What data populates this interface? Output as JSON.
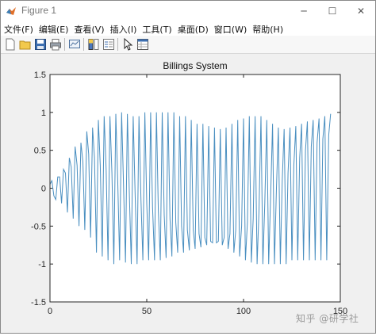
{
  "window": {
    "title": "Figure 1",
    "controls": {
      "minimize": "─",
      "maximize": "☐",
      "close": "✕"
    }
  },
  "menu": [
    {
      "label": "文件(F)"
    },
    {
      "label": "编辑(E)"
    },
    {
      "label": "查看(V)"
    },
    {
      "label": "插入(I)"
    },
    {
      "label": "工具(T)"
    },
    {
      "label": "桌面(D)"
    },
    {
      "label": "窗口(W)"
    },
    {
      "label": "帮助(H)"
    }
  ],
  "toolbar": {
    "icons": [
      "new-figure-icon",
      "open-file-icon",
      "save-icon",
      "print-icon",
      "link-plot-icon",
      "insert-colorbar-icon",
      "insert-legend-icon",
      "edit-plot-arrow-icon",
      "property-inspector-icon"
    ]
  },
  "chart_data": {
    "type": "line",
    "title": "Billings System",
    "xlabel": "",
    "ylabel": "",
    "xlim": [
      0,
      150
    ],
    "ylim": [
      -1.5,
      1.5
    ],
    "xticks": [
      "0",
      "50",
      "100",
      "150"
    ],
    "yticks": [
      "1.5",
      "1",
      "0.5",
      "0",
      "-0.5",
      "-1",
      "-1.5"
    ],
    "grid": false,
    "line_color": "#4a8fc0",
    "x": [
      0,
      1,
      2,
      3,
      4,
      5,
      6,
      7,
      8,
      9,
      10,
      11,
      12,
      13,
      14,
      15,
      16,
      17,
      18,
      19,
      20,
      21,
      22,
      23,
      24,
      25,
      26,
      27,
      28,
      29,
      30,
      31,
      32,
      33,
      34,
      35,
      36,
      37,
      38,
      39,
      40,
      41,
      42,
      43,
      44,
      45,
      46,
      47,
      48,
      49,
      50,
      51,
      52,
      53,
      54,
      55,
      56,
      57,
      58,
      59,
      60,
      61,
      62,
      63,
      64,
      65,
      66,
      67,
      68,
      69,
      70,
      71,
      72,
      73,
      74,
      75,
      76,
      77,
      78,
      79,
      80,
      81,
      82,
      83,
      84,
      85,
      86,
      87,
      88,
      89,
      90,
      91,
      92,
      93,
      94,
      95,
      96,
      97,
      98,
      99,
      100,
      101,
      102,
      103,
      104,
      105,
      106,
      107,
      108,
      109,
      110,
      111,
      112,
      113,
      114,
      115,
      116,
      117,
      118,
      119,
      120,
      121,
      122,
      123,
      124,
      125,
      126,
      127,
      128,
      129,
      130,
      131,
      132,
      133,
      134,
      135,
      136,
      137,
      138,
      139,
      140,
      141,
      142,
      143,
      144,
      145,
      146,
      147,
      148,
      149,
      150
    ],
    "y": [
      0.05,
      0.1,
      -0.1,
      -0.15,
      0.15,
      0.15,
      -0.2,
      0.25,
      0.2,
      -0.32,
      0.4,
      0.28,
      -0.4,
      0.55,
      0.3,
      -0.5,
      0.6,
      0.35,
      -0.55,
      0.75,
      0.45,
      -0.65,
      0.8,
      0.4,
      -0.85,
      0.9,
      0.3,
      -0.9,
      0.95,
      0.25,
      -0.95,
      0.95,
      0.2,
      -1.0,
      0.98,
      0.1,
      -0.95,
      1.0,
      0.05,
      -0.98,
      0.98,
      -0.05,
      -1.0,
      0.95,
      -0.1,
      -1.0,
      0.95,
      -0.15,
      -0.95,
      1.0,
      -0.2,
      -0.95,
      1.0,
      -0.25,
      -0.95,
      1.0,
      -0.3,
      -0.95,
      1.0,
      -0.35,
      -0.92,
      1.0,
      -0.4,
      -0.9,
      1.0,
      -0.45,
      -0.85,
      0.95,
      -0.5,
      -0.85,
      0.95,
      -0.55,
      -0.82,
      0.9,
      -0.55,
      -0.8,
      0.85,
      -0.6,
      -0.78,
      0.85,
      -0.65,
      -0.75,
      0.82,
      -0.7,
      -0.72,
      0.8,
      -0.72,
      -0.7,
      0.78,
      -0.75,
      -0.65,
      0.8,
      -0.8,
      -0.6,
      0.85,
      -0.85,
      -0.55,
      0.9,
      -0.9,
      -0.5,
      0.92,
      -0.95,
      -0.45,
      0.95,
      -0.98,
      -0.4,
      0.95,
      -1.0,
      -0.3,
      0.95,
      -1.0,
      -0.2,
      0.9,
      -1.0,
      -0.1,
      0.85,
      -1.0,
      0.0,
      0.8,
      -1.0,
      0.1,
      0.78,
      -1.0,
      0.2,
      0.8,
      -0.95,
      0.3,
      0.82,
      -0.95,
      0.4,
      0.85,
      -0.95,
      0.5,
      0.88,
      -0.95,
      0.55,
      0.9,
      -0.95,
      0.6,
      0.92,
      -0.95,
      0.65,
      0.95,
      -0.95,
      0.7,
      0.98
    ]
  },
  "watermark": "知乎 @研学社"
}
